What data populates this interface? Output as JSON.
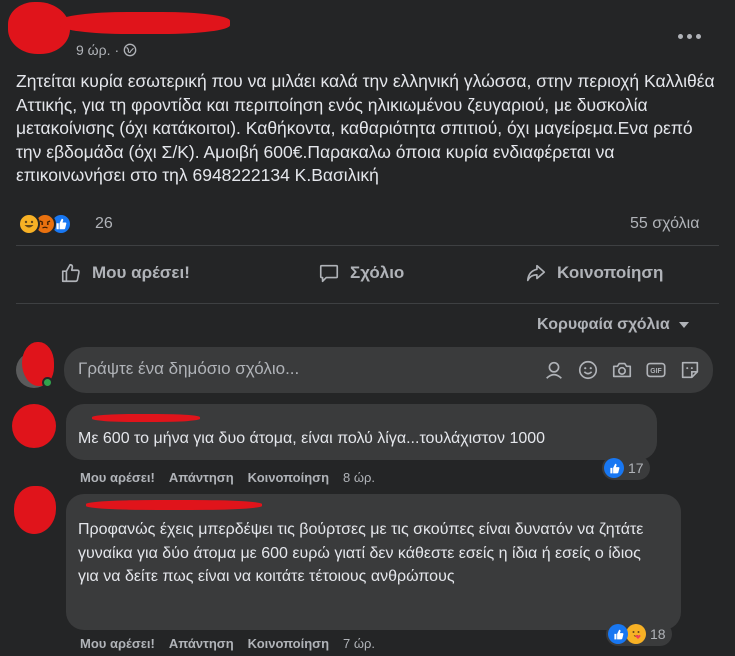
{
  "post": {
    "time": "9 ώρ.",
    "separator": "·",
    "text": "Ζητείται κυρία εσωτερική που να μιλάει καλά την ελληνική γλώσσα, στην περιοχή Καλλιθέα Αττικής, για τη φροντίδα και περιποίηση ενός ηλικιωμένου ζευγαριού, με δυσκολία μετακοίνισης (όχι κατάκοιτοι). Καθήκοντα, καθαριότητα σπιτιού, όχι μαγείρεμα.Ενα ρεπό την εβδομάδα (όχι Σ/Κ). Αμοιβή 600€.Παρακαλω όποια κυρία ενδιαφέρεται να επικοινωνήσει στο τηλ 6948222134 Κ.Βασιλική",
    "reaction_count": "26",
    "comment_count": "55 σχόλια"
  },
  "actions": {
    "like": "Μου αρέσει!",
    "comment": "Σχόλιο",
    "share": "Κοινοποίηση"
  },
  "sort": {
    "label": "Κορυφαία σχόλια"
  },
  "composer": {
    "placeholder": "Γράψτε ένα δημόσιο σχόλιο..."
  },
  "comments": [
    {
      "text": "Με 600 το μήνα για δυο άτομα, είναι πολύ λίγα...τουλάχιστον 1000",
      "like": "Μου αρέσει!",
      "reply": "Απάντηση",
      "share": "Κοινοποίηση",
      "time": "8 ώρ.",
      "reactions": "17"
    },
    {
      "text": "Προφανώς έχεις μπερδέψει τις βούρτσες με τις σκούπες είναι δυνατόν να ζητάτε γυναίκα για δύο άτομα με 600 ευρώ γιατί δεν κάθεστε εσείς η ίδια ή εσείς ο ίδιος για να δείτε πως είναι να κοιτάτε τέτοιους ανθρώπους",
      "like": "Μου αρέσει!",
      "reply": "Απάντηση",
      "share": "Κοινοποίηση",
      "time": "7 ώρ.",
      "reactions": "18"
    }
  ],
  "colors": {
    "background": "#242526",
    "bubble": "#3a3b3c",
    "text": "#e4e6eb",
    "muted": "#b0b3b8",
    "like_blue": "#1877f2",
    "redaction": "#e0141b"
  }
}
